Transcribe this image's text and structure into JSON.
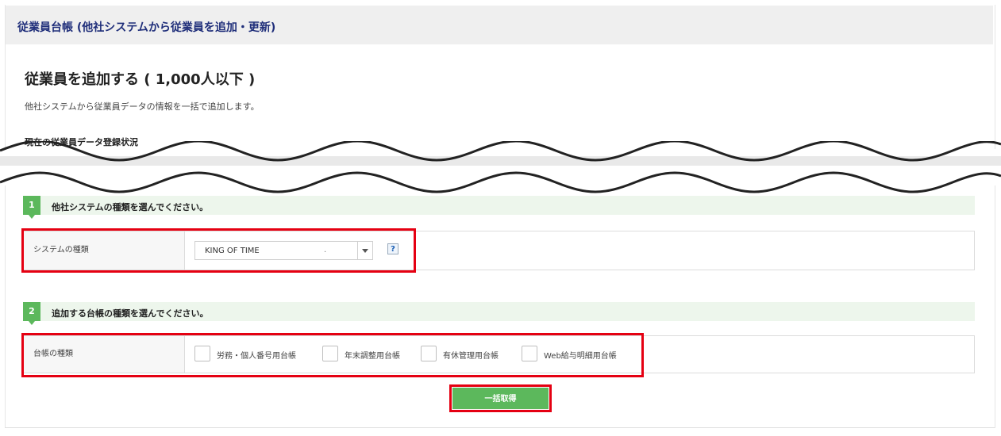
{
  "header": {
    "title": "従業員台帳 (他社システムから従業員を追加・更新)"
  },
  "section": {
    "title": "従業員を追加する ( 1,000人以下 )",
    "description": "他社システムから従業員データの情報を一括で追加します。",
    "status_title": "現在の従業員データ登録状況"
  },
  "step1": {
    "number": "1",
    "label": "他社システムの種類を選んでください。",
    "field_label": "システムの種類",
    "select_value": "KING OF TIME",
    "select_extra": ".",
    "help_icon": "?"
  },
  "step2": {
    "number": "2",
    "label": "追加する台帳の種類を選んでください。",
    "field_label": "台帳の種類",
    "options": [
      {
        "label": "労務・個人番号用台帳",
        "checked": false
      },
      {
        "label": "年末調整用台帳",
        "checked": false
      },
      {
        "label": "有休管理用台帳",
        "checked": false
      },
      {
        "label": "Web給与明細用台帳",
        "checked": false
      }
    ]
  },
  "submit": {
    "label": "一括取得"
  },
  "colors": {
    "accent_green": "#5cb85c",
    "highlight_red": "#e50012",
    "title_navy": "#1f2e7a"
  }
}
